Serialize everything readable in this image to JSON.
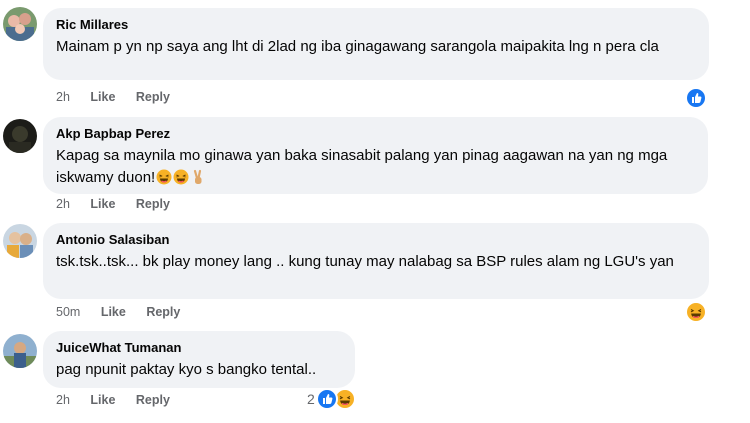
{
  "comments": [
    {
      "author": "Ric Millares",
      "text": "Mainam p yn np saya ang lht di 2lad ng iba ginagawang sarangola maipakita lng n pera cla",
      "time": "2h",
      "like_label": "Like",
      "reply_label": "Reply",
      "reactions": [
        "like-reaction-icon"
      ]
    },
    {
      "author": "Akp Bapbap Perez",
      "text": "Kapag sa maynila mo ginawa yan baka sinasabit palang yan pinag aagawan na yan ng mga iskwamy duon!",
      "emojis": [
        "laughing-emoji-icon",
        "laughing-emoji-icon",
        "victory-hand-emoji-icon"
      ],
      "time": "2h",
      "like_label": "Like",
      "reply_label": "Reply"
    },
    {
      "author": "Antonio Salasiban",
      "text": "tsk.tsk..tsk... bk play money lang .. kung tunay may nalabag sa BSP rules alam ng LGU's yan",
      "time": "50m",
      "like_label": "Like",
      "reply_label": "Reply",
      "reactions": [
        "haha-reaction-icon"
      ]
    },
    {
      "author": "JuiceWhat Tumanan",
      "text": "pag npunit paktay kyo s bangko tental..",
      "time": "2h",
      "like_label": "Like",
      "reply_label": "Reply",
      "reaction_count": "2",
      "reactions": [
        "like-reaction-icon",
        "haha-reaction-icon"
      ]
    }
  ],
  "colors": {
    "bubble": "#f0f2f5",
    "meta_text": "#65676b",
    "like_blue": "#1877f2",
    "haha_yellow": "#f7b125"
  }
}
